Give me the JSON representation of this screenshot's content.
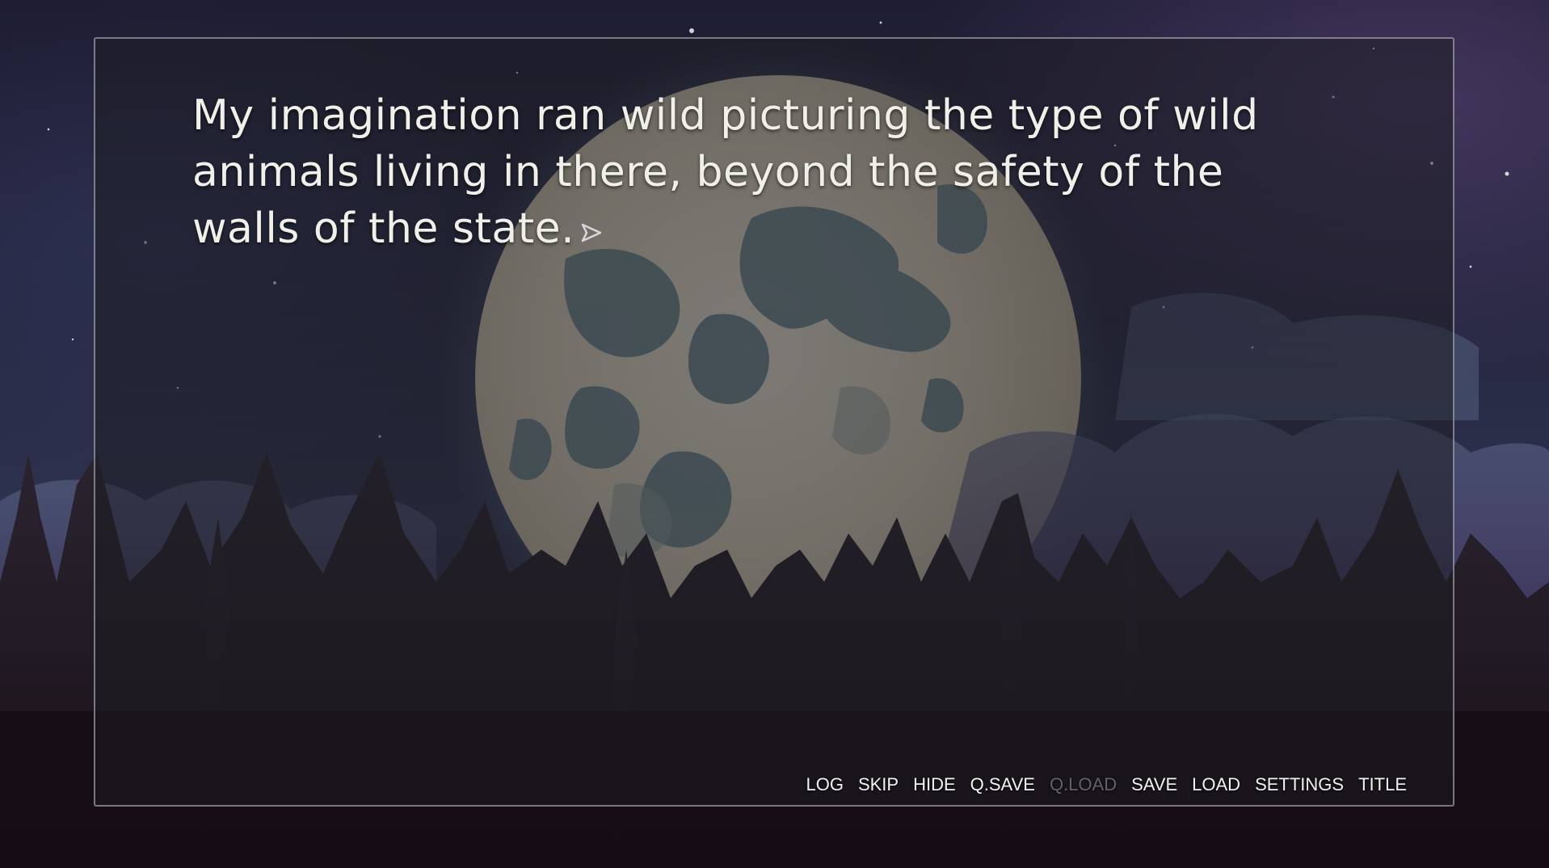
{
  "dialogue": {
    "text": "My imagination ran wild picturing the type of wild animals living in there, beyond the safety of the walls of the state."
  },
  "quick_menu": {
    "log": "LOG",
    "skip": "SKIP",
    "hide": "HIDE",
    "qsave": "Q.SAVE",
    "qload": "Q.LOAD",
    "save": "SAVE",
    "load": "LOAD",
    "settings": "SETTINGS",
    "title": "TITLE"
  },
  "icons": {
    "continue": "ctc-arrow-icon"
  },
  "colors": {
    "text": "#f1efe9",
    "menu_text": "#f2f2f2",
    "menu_disabled": "#8f8f8f",
    "box_border": "#c8c8d2"
  }
}
